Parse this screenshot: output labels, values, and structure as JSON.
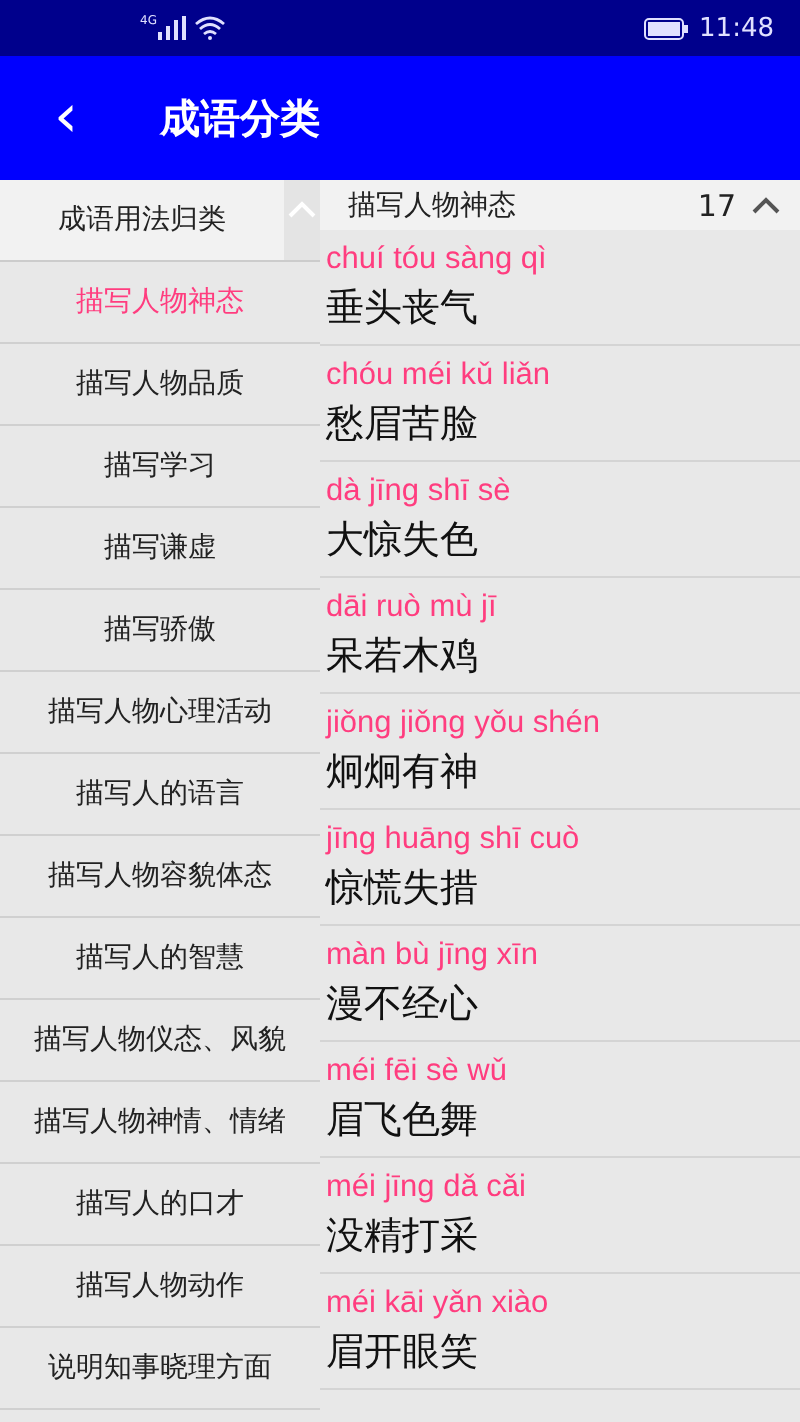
{
  "status_bar": {
    "network": "4G",
    "time": "11:48"
  },
  "app_bar": {
    "back_icon": "‹",
    "title": "成语分类"
  },
  "sidebar": {
    "header": "成语用法归类",
    "expanded": true,
    "items": [
      {
        "label": "描写人物神态",
        "selected": true
      },
      {
        "label": "描写人物品质",
        "selected": false
      },
      {
        "label": "描写学习",
        "selected": false
      },
      {
        "label": "描写谦虚",
        "selected": false
      },
      {
        "label": "描写骄傲",
        "selected": false
      },
      {
        "label": "描写人物心理活动",
        "selected": false
      },
      {
        "label": "描写人的语言",
        "selected": false
      },
      {
        "label": "描写人物容貌体态",
        "selected": false
      },
      {
        "label": "描写人的智慧",
        "selected": false
      },
      {
        "label": "描写人物仪态、风貌",
        "selected": false
      },
      {
        "label": "描写人物神情、情绪",
        "selected": false
      },
      {
        "label": "描写人的口才",
        "selected": false
      },
      {
        "label": "描写人物动作",
        "selected": false
      },
      {
        "label": "说明知事晓理方面",
        "selected": false
      }
    ]
  },
  "list": {
    "header": "描写人物神态",
    "count": "17",
    "expanded": true,
    "idioms": [
      {
        "pinyin": "chuí tóu sàng qì",
        "text": "垂头丧气"
      },
      {
        "pinyin": "chóu méi kǔ liǎn",
        "text": "愁眉苦脸"
      },
      {
        "pinyin": "dà jīng shī sè",
        "text": "大惊失色"
      },
      {
        "pinyin": "dāi ruò mù jī",
        "text": "呆若木鸡"
      },
      {
        "pinyin": "jiǒng jiǒng yǒu shén",
        "text": "炯炯有神"
      },
      {
        "pinyin": "jīng huāng shī cuò",
        "text": "惊慌失措"
      },
      {
        "pinyin": "màn bù jīng xīn",
        "text": "漫不经心"
      },
      {
        "pinyin": "méi fēi sè wǔ",
        "text": "眉飞色舞"
      },
      {
        "pinyin": "méi jīng dǎ cǎi",
        "text": "没精打采"
      },
      {
        "pinyin": "méi kāi yǎn xiào",
        "text": "眉开眼笑"
      }
    ]
  }
}
